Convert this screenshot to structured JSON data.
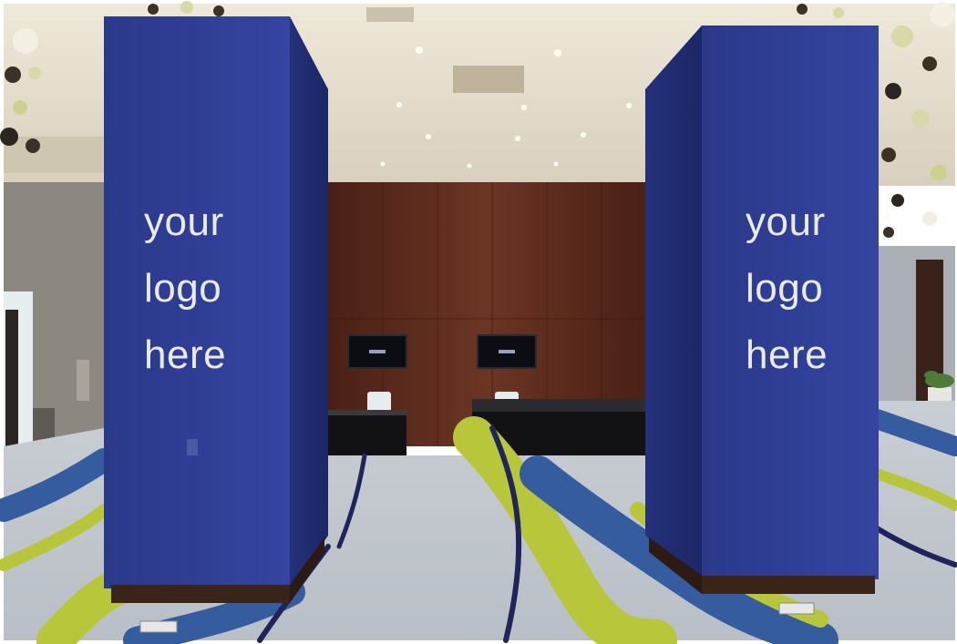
{
  "scene": {
    "description_free": true,
    "palette": {
      "pillar": "#2c3a8c",
      "wall_wood": "#5a2a1c",
      "ceiling": "#e7e1d3",
      "carpet_base": "#cfd3d8",
      "carpet_blue": "#355c9e",
      "carpet_lime": "#b8c63a",
      "carpet_navy": "#20245a"
    }
  },
  "pillars": {
    "left_text": "your\nlogo\nhere",
    "right_text": "your\nlogo\nhere"
  }
}
